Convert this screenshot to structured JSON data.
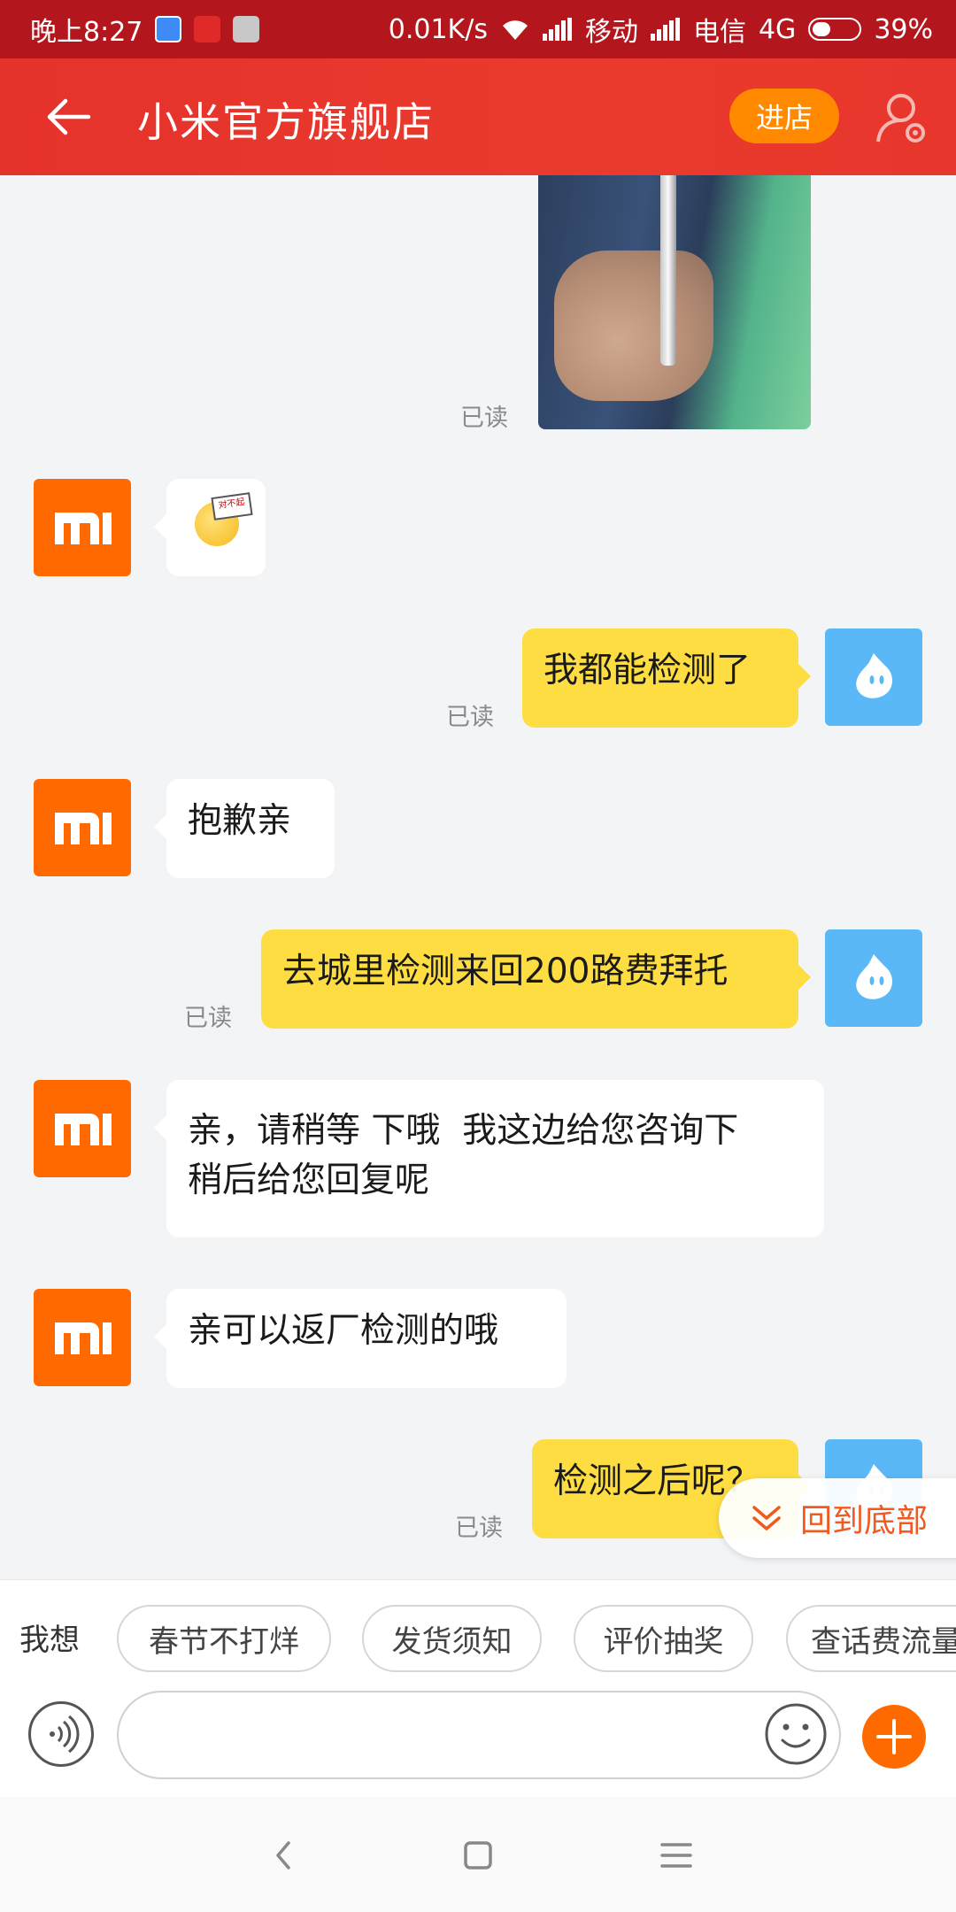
{
  "status_bar": {
    "time": "晚上8:27",
    "net_speed": "0.01K/s",
    "carrier1": "移动",
    "carrier2": "电信",
    "network_type": "4G",
    "battery": "39%"
  },
  "header": {
    "title": "小米官方旗舰店",
    "enter_store_label": "进店",
    "bg_color": "#e5322b",
    "button_color": "#ff8a00"
  },
  "messages": [
    {
      "from": "me",
      "type": "image",
      "status": "已读"
    },
    {
      "from": "store",
      "type": "sticker",
      "sticker_text": "对不起"
    },
    {
      "from": "me",
      "type": "text",
      "text": "我都能检测了",
      "status": "已读"
    },
    {
      "from": "store",
      "type": "text",
      "text": "抱歉亲"
    },
    {
      "from": "me",
      "type": "text",
      "text": "去城里检测来回200路费拜托",
      "status": "已读"
    },
    {
      "from": "store",
      "type": "text",
      "line1": "亲，请稍等 下哦  我这边给您咨询下",
      "line2": "稍后给您回复呢"
    },
    {
      "from": "store",
      "type": "text",
      "text": "亲可以返厂检测的哦"
    },
    {
      "from": "me",
      "type": "text",
      "text": "检测之后呢？",
      "status": "已读"
    }
  ],
  "scroll_to_bottom_label": "回到底部",
  "quick_replies": {
    "prefix": "我想",
    "chips": [
      "春节不打烊",
      "发货须知",
      "评价抽奖",
      "查话费流量"
    ]
  },
  "input": {
    "placeholder": ""
  },
  "colors": {
    "incoming_bubble": "#ffffff",
    "outgoing_bubble": "#fddd42",
    "mi_brand": "#ff6900",
    "user_avatar": "#5ab8f6",
    "accent": "#f05a1e"
  },
  "icons": [
    "back-arrow-icon",
    "user-settings-icon",
    "mi-logo-icon",
    "user-avatar-icon",
    "chevron-down-icon",
    "voice-icon",
    "emoji-icon",
    "plus-icon",
    "nav-back-icon",
    "nav-home-icon",
    "nav-menu-icon"
  ]
}
